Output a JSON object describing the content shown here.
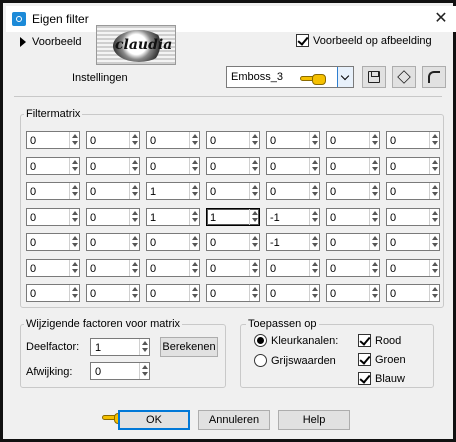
{
  "window": {
    "title": "Eigen filter",
    "close_glyph": "✕"
  },
  "top": {
    "preview_label": "Voorbeeld",
    "logo_text": "claudia",
    "preview_on_image_label": "Voorbeeld op afbeelding",
    "preview_on_image_checked": true
  },
  "settings": {
    "label": "Instellingen",
    "preset_value": "Emboss_3"
  },
  "matrix": {
    "title": "Filtermatrix",
    "rows": [
      [
        "0",
        "0",
        "0",
        "0",
        "0",
        "0",
        "0"
      ],
      [
        "0",
        "0",
        "0",
        "0",
        "0",
        "0",
        "0"
      ],
      [
        "0",
        "0",
        "1",
        "0",
        "0",
        "0",
        "0"
      ],
      [
        "0",
        "0",
        "1",
        "1",
        "-1",
        "0",
        "0"
      ],
      [
        "0",
        "0",
        "0",
        "0",
        "-1",
        "0",
        "0"
      ],
      [
        "0",
        "0",
        "0",
        "0",
        "0",
        "0",
        "0"
      ],
      [
        "0",
        "0",
        "0",
        "0",
        "0",
        "0",
        "0"
      ]
    ]
  },
  "factors": {
    "title": "Wijzigende factoren voor matrix",
    "divisor_label": "Deelfactor:",
    "divisor_value": "1",
    "calculate_label": "Berekenen",
    "bias_label": "Afwijking:",
    "bias_value": "0"
  },
  "apply": {
    "title": "Toepassen op",
    "color_channels_label": "Kleurkanalen:",
    "color_channels_selected": true,
    "grayscale_label": "Grijswaarden",
    "red_label": "Rood",
    "green_label": "Groen",
    "blue_label": "Blauw"
  },
  "buttons": {
    "ok": "OK",
    "cancel": "Annuleren",
    "help": "Help"
  },
  "colors": {
    "accent": "#0078d7",
    "pointer_hand": "#f5c000",
    "app_icon": "#1c8ad8"
  },
  "icons": [
    "app-icon",
    "close-icon",
    "expand-triangle-icon",
    "save-preset-icon",
    "randomize-icon",
    "reset-icon",
    "pointer-hand-icon"
  ]
}
